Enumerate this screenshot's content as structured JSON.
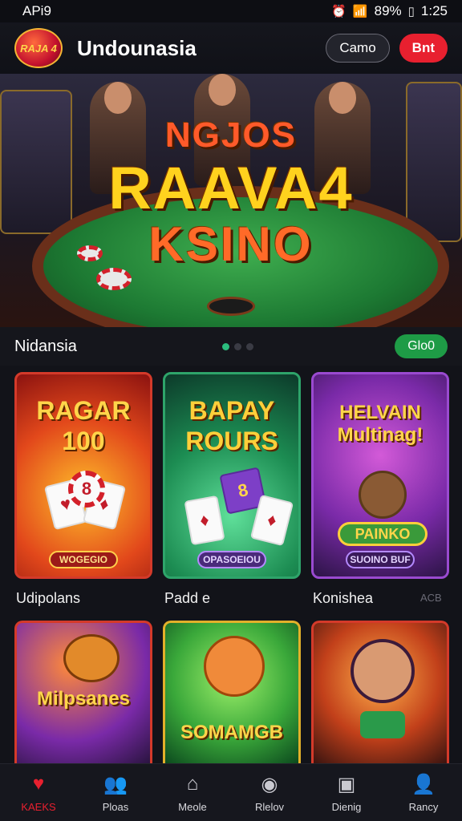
{
  "status_bar": {
    "left": "APi9",
    "battery": "89%",
    "time": "1:25"
  },
  "header": {
    "logo_text": "RAJA 4",
    "title": "Undounasia",
    "btn_login": "Camo",
    "btn_register": "Bnt"
  },
  "banner": {
    "line1": "NGJOS",
    "line2": "RAAVA4",
    "line3": "KSINO"
  },
  "section": {
    "title": "Nidansia",
    "button": "Glo0"
  },
  "games": [
    {
      "title": "RAGAR 100",
      "pill": "WOGEGIO",
      "label": "Udipolans"
    },
    {
      "title": "BAPAY ROURS",
      "pill": "OPASOEIOU",
      "label": "Padd e"
    },
    {
      "title": "HELVAIN Multinag!",
      "pill": "SUOINO BUF",
      "label": "Konishea",
      "extra": "ACB"
    },
    {
      "title": "Milpsanes",
      "pill": "",
      "label": ""
    },
    {
      "title": "SOMAMGB",
      "pill": "",
      "label": ""
    },
    {
      "title": "",
      "pill": "",
      "label": ""
    }
  ],
  "nav": [
    {
      "label": "KAEKS",
      "icon": "heart-icon"
    },
    {
      "label": "Ploas",
      "icon": "people-icon"
    },
    {
      "label": "Meole",
      "icon": "home-icon"
    },
    {
      "label": "Rlelov",
      "icon": "profile-icon"
    },
    {
      "label": "Dienig",
      "icon": "dining-icon"
    },
    {
      "label": "Rancy",
      "icon": "user-icon"
    }
  ]
}
